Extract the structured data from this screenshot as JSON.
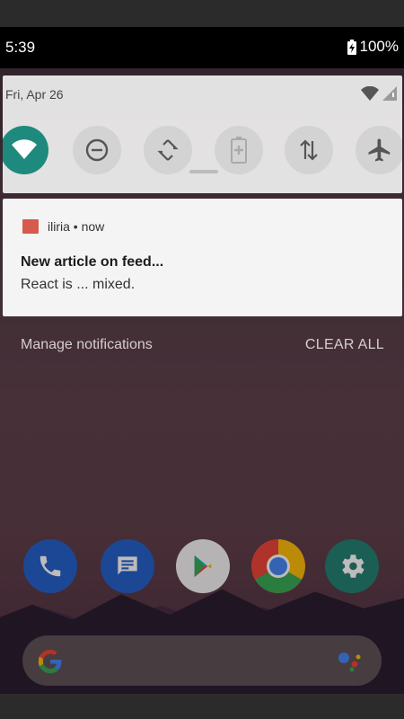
{
  "status_bar": {
    "time": "5:39",
    "battery": "100%"
  },
  "quick_settings": {
    "date": "Fri, Apr 26",
    "tiles": [
      {
        "name": "wifi",
        "icon": "wifi-icon",
        "active": true
      },
      {
        "name": "dnd",
        "icon": "do-not-disturb-icon",
        "active": false
      },
      {
        "name": "auto-rotate",
        "icon": "auto-rotate-icon",
        "active": false
      },
      {
        "name": "battery-saver",
        "icon": "battery-saver-icon",
        "active": false
      },
      {
        "name": "mobile-data",
        "icon": "mobile-data-icon",
        "active": false
      },
      {
        "name": "airplane-mode",
        "icon": "airplane-icon",
        "active": false
      }
    ]
  },
  "notification": {
    "app": "iliria",
    "separator": "•",
    "time": "now",
    "title": "New article on feed...",
    "text": "React is ... mixed.",
    "app_color": "#d65a4e"
  },
  "actions": {
    "manage": "Manage notifications",
    "clear_all": "CLEAR ALL"
  },
  "dock": [
    {
      "name": "phone",
      "icon": "phone-icon",
      "color": "#1f5fc9"
    },
    {
      "name": "messages",
      "icon": "messages-icon",
      "color": "#1f5fc9"
    },
    {
      "name": "play-store",
      "icon": "play-store-icon",
      "color": "#f4f4f4"
    },
    {
      "name": "chrome",
      "icon": "chrome-icon",
      "color": "#e8463a"
    },
    {
      "name": "settings",
      "icon": "gear-icon",
      "color": "#1e7f6f"
    }
  ],
  "colors": {
    "accent": "#1e8a7d",
    "status_bar": "#000000"
  }
}
